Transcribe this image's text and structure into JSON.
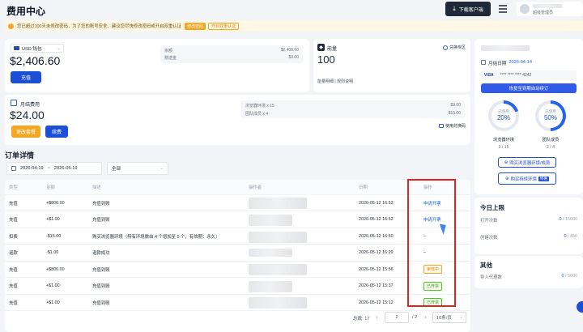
{
  "header": {
    "title": "费用中心",
    "download_label": "下载客户端",
    "user_name": "超级管理员"
  },
  "notice": {
    "text": "您已超过100天未修改密码，为了您的账号安全，建议您尽快修改密码或开启双重认证",
    "btn_change": "修改密码",
    "btn_2fa": "开启双重认证"
  },
  "wallet": {
    "currency": "USD 钱包",
    "balance": "$2,406.60",
    "recharge_label": "充值",
    "lines": [
      {
        "label": "余额",
        "value": "$2,406.60"
      },
      {
        "label": "赠送金",
        "value": "$0.00"
      }
    ]
  },
  "energy": {
    "title": "能量",
    "store_label": "兑换专区",
    "value": "100",
    "footer": "能量明细 | 规则说明"
  },
  "monthly": {
    "title": "月结费用",
    "amount": "$24.00",
    "btn_plan": "更改套餐",
    "btn_renew": "续费",
    "lines": [
      {
        "label": "浏览器环境 x 15",
        "value": "$9.00"
      },
      {
        "label": "团队成员 x 4",
        "value": "$15.00"
      }
    ],
    "coupon_label": "使用兑换码"
  },
  "orders": {
    "section_title": "订单详情",
    "date_from": "2026-04-19",
    "date_sep": "~",
    "date_to": "2026-05-19",
    "type_filter": "全部",
    "columns": [
      "类型",
      "金额",
      "描述",
      "操作者",
      "日期",
      "操作"
    ],
    "rows": [
      {
        "type": "充值",
        "amount": "+$800.00",
        "desc": "充值到账",
        "date": "2026-05-12 16:52",
        "action": "申请开票",
        "action_kind": "link"
      },
      {
        "type": "充值",
        "amount": "+$1.00",
        "desc": "充值到账",
        "date": "2026-05-12 16:52",
        "action": "申请开票",
        "action_kind": "link"
      },
      {
        "type": "扣费",
        "amount": "-$15.00",
        "desc": "购买浏览器环境（持有环境数由 4 个增加至 5 个，有效期：永久）",
        "date": "2026-05-12 16:50",
        "action": "–",
        "action_kind": "text"
      },
      {
        "type": "退款",
        "amount": "-$1.00",
        "desc": "退款成功",
        "date": "2026-05-12 16:29",
        "action": "–",
        "action_kind": "text"
      },
      {
        "type": "充值",
        "amount": "+$800.00",
        "desc": "充值到账",
        "date": "2026-05-12 15:56",
        "action": "审核中",
        "action_kind": "warn"
      },
      {
        "type": "充值",
        "amount": "+$1.00",
        "desc": "充值到账",
        "date": "2026-05-12 15:37",
        "action": "已开票",
        "action_kind": "ok"
      },
      {
        "type": "充值",
        "amount": "+$1.00",
        "desc": "充值到账",
        "date": "2026-05-12 15:12",
        "action": "已开票",
        "action_kind": "ok"
      }
    ],
    "pagination": {
      "total_label": "总数: 17",
      "prev": "‹",
      "page": "2",
      "page_total": "/ 2",
      "next": "›",
      "page_size": "10条/页"
    }
  },
  "side": {
    "billing_date_label": "月结日期",
    "billing_date": "2026-04-14",
    "card_brand": "VISA",
    "card_number": "**** **** **** 4242",
    "autopay_label": "恢复至到期自动续订",
    "rings": [
      {
        "caption_top": "已使用",
        "percent": "20%",
        "fill": 0.2,
        "label": "浏览器环境",
        "count": "3 / 15"
      },
      {
        "caption_top": "已使用",
        "percent": "50%",
        "fill": 0.5,
        "label": "团队成员",
        "count": "2 / 4"
      }
    ],
    "buy_env_members": "购买浏览器环境/成员",
    "buy_pkg": "购买持续环境",
    "buy_pkg_badge": "特惠",
    "today_title": "今日上限",
    "today": [
      {
        "label": "打开次数",
        "value": "0",
        "total": "/ 15000"
      },
      {
        "label": "创建次数",
        "value": "0",
        "total": "/ 450"
      }
    ],
    "other_title": "其他",
    "other": [
      {
        "label": "导入代理数",
        "value": "0",
        "total": "/ 5000"
      }
    ]
  },
  "colors": {
    "primary": "#2563eb",
    "accent_orange": "#f5a623",
    "ok_green": "#52c41a",
    "highlight_red": "#e02424"
  }
}
